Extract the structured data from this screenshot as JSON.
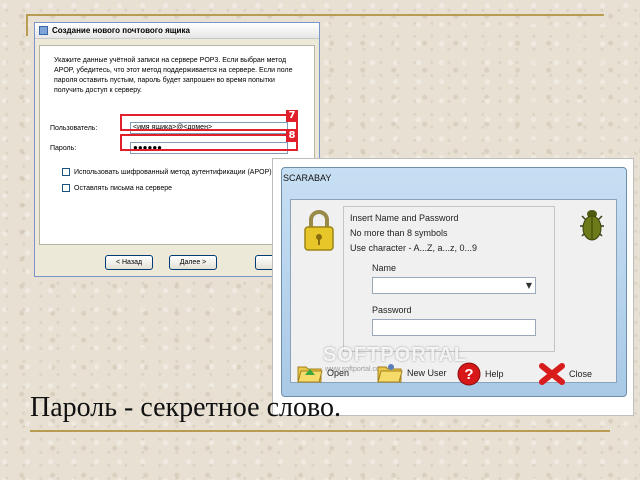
{
  "dialog": {
    "title": "Создание нового почтового ящика",
    "description": "Укажите данные учётной записи на сервере POP3. Если выбран метод APOP, убедитесь, что этот метод поддерживается на сервере. Если поле пароля оставить пустым, пароль будет запрошен во время попытки получить доступ к серверу.",
    "user_label": "Пользователь:",
    "user_value": "<имя ящика>@<домен>",
    "password_label": "Пароль:",
    "password_value": "●●●●●●",
    "marker_user": "7",
    "marker_password": "8",
    "checkbox_apop": "Использовать шифрованный метод аутентификации (APOP)",
    "checkbox_keep": "Оставлять письма на сервере",
    "back_button": "< Назад",
    "next_button": "Далее >",
    "cancel_button": "Отм"
  },
  "scarabay": {
    "title": "SCARABAY",
    "line1": "Insert Name and Password",
    "line2": "No more than 8 symbols",
    "line3": "Use character - A...Z, a...z, 0...9",
    "name_label": "Name",
    "password_label": "Password",
    "toolbar": {
      "open": "Open",
      "new_user": "New User",
      "help": "Help",
      "close": "Close"
    },
    "watermark": "SOFTPORTAL",
    "watermark_url": "www.softportal.com"
  },
  "caption": "Пароль - секретное слово.",
  "colors": {
    "accent_red": "#e0202a",
    "rule_gold": "#b89c52",
    "frame_blue": "#a9c9e6"
  }
}
